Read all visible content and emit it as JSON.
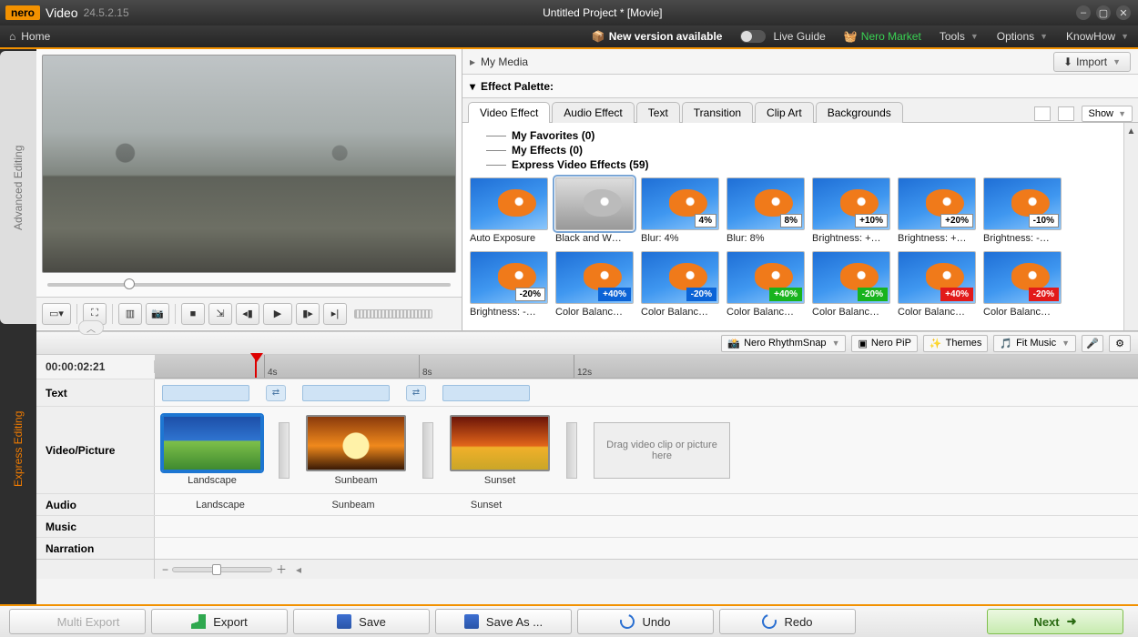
{
  "app": {
    "brand": "nero",
    "name": "Video",
    "version": "24.5.2.15",
    "title": "Untitled Project * [Movie]"
  },
  "menubar": {
    "home": "Home",
    "new_version": "New version available",
    "live_guide": "Live Guide",
    "market": "Nero Market",
    "tools": "Tools",
    "options": "Options",
    "knowhow": "KnowHow"
  },
  "side_tabs": {
    "advanced": "Advanced Editing",
    "express": "Express Editing"
  },
  "mymedia": {
    "label": "My Media",
    "import": "Import"
  },
  "palette": {
    "header": "Effect Palette:",
    "tabs": [
      "Video Effect",
      "Audio Effect",
      "Text",
      "Transition",
      "Clip Art",
      "Backgrounds"
    ],
    "show": "Show",
    "tree": {
      "favorites": "My Favorites (0)",
      "myeffects": "My Effects (0)",
      "express": "Express Video Effects (59)"
    },
    "effects_row1": [
      {
        "label": "Auto Exposure",
        "badge": "",
        "cls": ""
      },
      {
        "label": "Black and W…",
        "badge": "",
        "cls": "",
        "selected": true
      },
      {
        "label": "Blur: 4%",
        "badge": "4%",
        "cls": ""
      },
      {
        "label": "Blur: 8%",
        "badge": "8%",
        "cls": ""
      },
      {
        "label": "Brightness: +…",
        "badge": "+10%",
        "cls": ""
      },
      {
        "label": "Brightness: +…",
        "badge": "+20%",
        "cls": ""
      },
      {
        "label": "Brightness: -…",
        "badge": "-10%",
        "cls": ""
      }
    ],
    "effects_row2": [
      {
        "label": "Brightness: -…",
        "badge": "-20%",
        "cls": ""
      },
      {
        "label": "Color Balanc…",
        "badge": "+40%",
        "cls": "blue"
      },
      {
        "label": "Color Balanc…",
        "badge": "-20%",
        "cls": "blue"
      },
      {
        "label": "Color Balanc…",
        "badge": "+40%",
        "cls": "green"
      },
      {
        "label": "Color Balanc…",
        "badge": "-20%",
        "cls": "green"
      },
      {
        "label": "Color Balanc…",
        "badge": "+40%",
        "cls": "red"
      },
      {
        "label": "Color Balanc…",
        "badge": "-20%",
        "cls": "red"
      }
    ]
  },
  "mid_toolbar": {
    "rhythm": "Nero RhythmSnap",
    "pip": "Nero PiP",
    "themes": "Themes",
    "fitmusic": "Fit Music"
  },
  "timeline": {
    "timecode": "00:00:02:21",
    "ticks": [
      "4s",
      "8s",
      "12s"
    ],
    "rows": {
      "text": "Text",
      "video": "Video/Picture",
      "audio": "Audio",
      "music": "Music",
      "narration": "Narration"
    },
    "clips": [
      {
        "name": "Landscape",
        "cls": "landscape",
        "selected": true
      },
      {
        "name": "Sunbeam",
        "cls": "sunbeam",
        "selected": false
      },
      {
        "name": "Sunset",
        "cls": "sunset",
        "selected": false
      }
    ],
    "drop_hint": "Drag video clip or picture here"
  },
  "bottom": {
    "multi_export": "Multi Export",
    "export": "Export",
    "save": "Save",
    "saveas": "Save As ...",
    "undo": "Undo",
    "redo": "Redo",
    "next": "Next"
  }
}
